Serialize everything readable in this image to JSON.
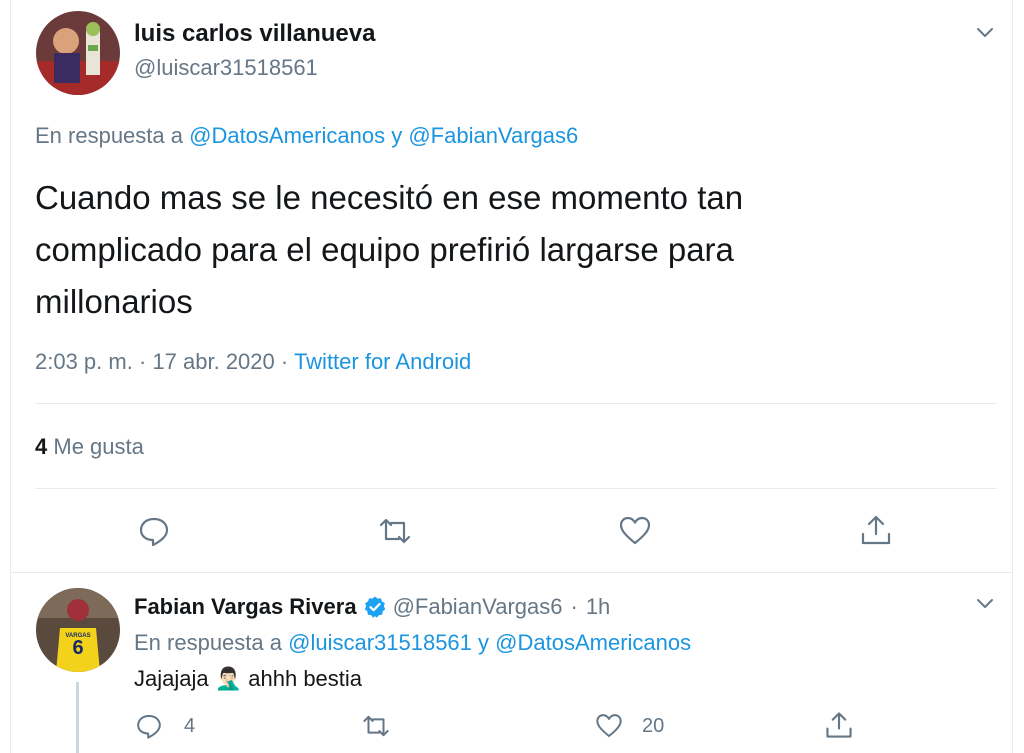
{
  "main_tweet": {
    "display_name": "luis carlos villanueva",
    "handle": "@luiscar31518561",
    "reply_to": {
      "prefix": "En respuesta a",
      "handle_1": "@DatosAmericanos",
      "conjunction": "y",
      "handle_2": "@FabianVargas6"
    },
    "text_line_1": "Cuando mas se le necesitó en ese momento tan",
    "text_line_2": "complicado para el equipo prefirió largarse para",
    "text_line_3": "millonarios",
    "time": "2:03 p. m.",
    "dot": "·",
    "date": "17 abr. 2020",
    "source": "Twitter for Android",
    "likes_count": "4",
    "likes_label": "Me gusta"
  },
  "reply_tweet": {
    "display_name": "Fabian Vargas Rivera",
    "handle": "@FabianVargas6",
    "dot": "·",
    "time_ago": "1h",
    "reply_to": {
      "prefix": "En respuesta a",
      "handle_1": "@luiscar31518561",
      "conjunction": "y",
      "handle_2": "@DatosAmericanos"
    },
    "text_before": "Jajajaja",
    "emoji": "🤦🏻‍♂️",
    "text_after": "ahhh bestia",
    "reply_count": "4",
    "like_count": "20",
    "jersey_number": "6",
    "jersey_name": "VARGAS"
  },
  "colors": {
    "link": "#1b95e0",
    "muted": "#657786",
    "text": "#14171a",
    "verified": "#1da1f2",
    "border": "#e6ecf0"
  },
  "icons": [
    "chevron-down-icon",
    "reply-icon",
    "retweet-icon",
    "like-icon",
    "share-icon",
    "verified-icon"
  ]
}
